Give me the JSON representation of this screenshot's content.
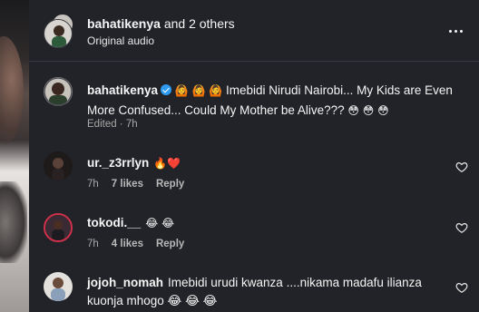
{
  "header": {
    "user": "bahatikenya",
    "others": " and 2 others",
    "audio": "Original audio",
    "more_icon": "more-horizontal-icon"
  },
  "caption": {
    "user": "bahatikenya",
    "emojis_lead": "🙆 🙆 🙆",
    "text": "Imebidi Nirudi Nairobi... My Kids are Even More Confused... Could My Mother be Alive???",
    "emojis_tail": "😳 😳 😳",
    "edited": "Edited",
    "time": "7h"
  },
  "comments": [
    {
      "user": "ur._z3rrlyn",
      "text": "🔥❤️",
      "time": "7h",
      "likes": "7 likes",
      "reply": "Reply"
    },
    {
      "user": "tokodi.__",
      "text": "😂 😂",
      "time": "7h",
      "likes": "4 likes",
      "reply": "Reply"
    },
    {
      "user": "jojoh_nomah",
      "text": "Imebidi urudi kwanza ....nikama madafu ilianza kuonja mhogo 😂 😂 😂",
      "time": "",
      "likes": "",
      "reply": ""
    }
  ],
  "colors": {
    "background": "#212328",
    "verified": "#2f9bf0",
    "muted": "#a8a8a8"
  }
}
